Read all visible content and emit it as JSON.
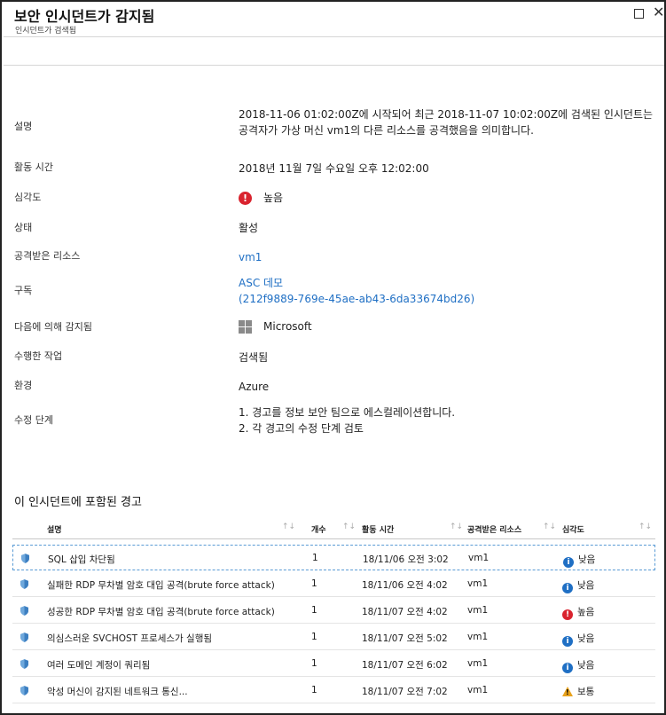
{
  "header": {
    "title": "보안 인시던트가 감지됨",
    "subtitle": "인시던트가 검색됨",
    "maximize_icon": "maximize-icon",
    "close_glyph": "✕"
  },
  "properties": [
    {
      "label": "설명",
      "value": "2018-11-06 01:02:00Z에 시작되어 최근 2018-11-07 10:02:00Z에 검색된 인시던트는 공격자가 가상 머신 vm1의 다른 리소스를 공격했음을 의미합니다."
    },
    {
      "label": "활동 시간",
      "value": "2018년 11월 7일 수요일 오후 12:02:00"
    },
    {
      "label": "심각도",
      "value": "높음",
      "icon": "error-icon"
    },
    {
      "label": "상태",
      "value": "활성"
    },
    {
      "label": "공격받은 리소스",
      "value": "vm1"
    },
    {
      "label": "구독",
      "value": "ASC 데모",
      "value2": "(212f9889-769e-45ae-ab43-6da33674bd26)"
    },
    {
      "label": "다음에 의해 감지됨",
      "value": "Microsoft",
      "icon": "microsoft-logo-icon"
    },
    {
      "label": "수행한 작업",
      "value": "검색됨"
    },
    {
      "label": "환경",
      "value": "Azure"
    },
    {
      "label": "수정 단계",
      "value": "1. 경고를 정보 보안 팀으로 에스컬레이션합니다.",
      "value2": "2. 각 경고의 수정 단계 검토"
    }
  ],
  "alerts_section": {
    "title": "이 인시던트에 포함된 경고",
    "columns": [
      "설명",
      "개수",
      "활동 시간",
      "공격받은 리소스",
      "심각도"
    ],
    "sort_glyph": "↑↓",
    "rows": [
      {
        "description": "SQL 삽입 차단됨",
        "count": "1",
        "time": "18/11/06 오전 3:02",
        "resource": "vm1",
        "severity": "낮음",
        "severity_level": "low"
      },
      {
        "description": "실패한 RDP 무차별 암호 대입 공격(brute force attack)",
        "count": "1",
        "time": "18/11/06 오전 4:02",
        "resource": "vm1",
        "severity": "낮음",
        "severity_level": "low"
      },
      {
        "description": "성공한 RDP 무차별 암호 대입 공격(brute force attack)",
        "count": "1",
        "time": "18/11/07 오전 4:02",
        "resource": "vm1",
        "severity": "높음",
        "severity_level": "high"
      },
      {
        "description": "의심스러운 SVCHOST 프로세스가 실행됨",
        "count": "1",
        "time": "18/11/07 오전 5:02",
        "resource": "vm1",
        "severity": "낮음",
        "severity_level": "low"
      },
      {
        "description": "여러 도메인 계정이 쿼리됨",
        "count": "1",
        "time": "18/11/07 오전 6:02",
        "resource": "vm1",
        "severity": "낮음",
        "severity_level": "low"
      },
      {
        "description": "악성 머신이 감지된 네트워크 통신...",
        "count": "1",
        "time": "18/11/07 오전 7:02",
        "resource": "vm1",
        "severity": "보통",
        "severity_level": "medium"
      }
    ]
  },
  "colors": {
    "link": "#1f6fc4",
    "high": "#d9232e",
    "low": "#1f6fc4",
    "medium": "#e8a21c"
  }
}
